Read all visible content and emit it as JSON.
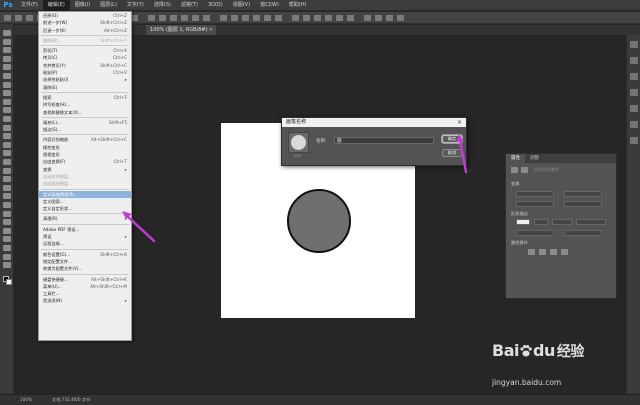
{
  "menubar": {
    "app_logo": "Ps",
    "items": [
      "文件(F)",
      "编辑(E)",
      "图像(I)",
      "图层(L)",
      "文字(Y)",
      "选择(S)",
      "滤镜(T)",
      "3D(D)",
      "视图(V)",
      "窗口(W)",
      "帮助(H)"
    ],
    "active_index": 1
  },
  "document_tab": {
    "label": "100% (图层 1, RGB/8#)",
    "close": "×"
  },
  "edit_menu": {
    "rows": [
      {
        "type": "item",
        "label": "还原(O)",
        "shortcut": "Ctrl+Z",
        "disabled": false
      },
      {
        "type": "item",
        "label": "前进一步(W)",
        "shortcut": "Shift+Ctrl+Z",
        "disabled": false
      },
      {
        "type": "item",
        "label": "后退一步(K)",
        "shortcut": "Alt+Ctrl+Z",
        "disabled": false
      },
      {
        "type": "sep"
      },
      {
        "type": "item",
        "label": "渐隐(D)...",
        "shortcut": "Shift+Ctrl+F",
        "disabled": true
      },
      {
        "type": "sep"
      },
      {
        "type": "item",
        "label": "剪切(T)",
        "shortcut": "Ctrl+X",
        "disabled": false
      },
      {
        "type": "item",
        "label": "拷贝(C)",
        "shortcut": "Ctrl+C",
        "disabled": false
      },
      {
        "type": "item",
        "label": "合并拷贝(Y)",
        "shortcut": "Shift+Ctrl+C",
        "disabled": false
      },
      {
        "type": "item",
        "label": "粘贴(P)",
        "shortcut": "Ctrl+V",
        "disabled": false
      },
      {
        "type": "item",
        "label": "选择性粘贴(I)",
        "shortcut": "▸",
        "disabled": false
      },
      {
        "type": "item",
        "label": "清除(E)",
        "shortcut": "",
        "disabled": false
      },
      {
        "type": "sep"
      },
      {
        "type": "item",
        "label": "搜索",
        "shortcut": "Ctrl+F",
        "disabled": false
      },
      {
        "type": "item",
        "label": "拼写检查(H)...",
        "shortcut": "",
        "disabled": false
      },
      {
        "type": "item",
        "label": "查找和替换文本(X)...",
        "shortcut": "",
        "disabled": false
      },
      {
        "type": "sep"
      },
      {
        "type": "item",
        "label": "填充(L)...",
        "shortcut": "Shift+F5",
        "disabled": false
      },
      {
        "type": "item",
        "label": "描边(S)...",
        "shortcut": "",
        "disabled": false
      },
      {
        "type": "sep"
      },
      {
        "type": "item",
        "label": "内容识别缩放",
        "shortcut": "Alt+Shift+Ctrl+C",
        "disabled": false
      },
      {
        "type": "item",
        "label": "操控变形",
        "shortcut": "",
        "disabled": false
      },
      {
        "type": "item",
        "label": "透视变形",
        "shortcut": "",
        "disabled": false
      },
      {
        "type": "item",
        "label": "自由变换(F)",
        "shortcut": "Ctrl+T",
        "disabled": false
      },
      {
        "type": "item",
        "label": "变换",
        "shortcut": "▸",
        "disabled": false
      },
      {
        "type": "item",
        "label": "自动对齐图层...",
        "shortcut": "",
        "disabled": true
      },
      {
        "type": "item",
        "label": "自动混合图层...",
        "shortcut": "",
        "disabled": true
      },
      {
        "type": "sep"
      },
      {
        "type": "item",
        "label": "定义画笔预设(B)...",
        "shortcut": "",
        "disabled": false,
        "highlight": true
      },
      {
        "type": "item",
        "label": "定义图案...",
        "shortcut": "",
        "disabled": false
      },
      {
        "type": "item",
        "label": "定义自定形状...",
        "shortcut": "",
        "disabled": false
      },
      {
        "type": "sep"
      },
      {
        "type": "item",
        "label": "清理(R)",
        "shortcut": "▸",
        "disabled": false
      },
      {
        "type": "sep"
      },
      {
        "type": "item",
        "label": "Adobe PDF 预设...",
        "shortcut": "",
        "disabled": false
      },
      {
        "type": "item",
        "label": "预设",
        "shortcut": "▸",
        "disabled": false
      },
      {
        "type": "item",
        "label": "远程连接...",
        "shortcut": "",
        "disabled": false
      },
      {
        "type": "sep"
      },
      {
        "type": "item",
        "label": "颜色设置(G)...",
        "shortcut": "Shift+Ctrl+K",
        "disabled": false
      },
      {
        "type": "item",
        "label": "指定配置文件...",
        "shortcut": "",
        "disabled": false
      },
      {
        "type": "item",
        "label": "转换为配置文件(V)...",
        "shortcut": "",
        "disabled": false
      },
      {
        "type": "sep"
      },
      {
        "type": "item",
        "label": "键盘快捷键...",
        "shortcut": "Alt+Shift+Ctrl+K",
        "disabled": false
      },
      {
        "type": "item",
        "label": "菜单(U)...",
        "shortcut": "Alt+Shift+Ctrl+M",
        "disabled": false
      },
      {
        "type": "item",
        "label": "工具栏...",
        "shortcut": "",
        "disabled": false
      },
      {
        "type": "item",
        "label": "首选项(N)",
        "shortcut": "▸",
        "disabled": false
      }
    ]
  },
  "dialog": {
    "title": "画笔名称",
    "close": "×",
    "name_label": "名称:",
    "name_value": "圆",
    "preview_size": "230",
    "ok_label": "确定",
    "cancel_label": "取消"
  },
  "properties_panel": {
    "tabs": [
      "属性",
      "调整"
    ],
    "shape_label": "实时形状属性",
    "transform_label": "变换",
    "stroke_label": "形状描边",
    "ops_label": "路径操作"
  },
  "statusbar": {
    "zoom": "100%",
    "doc_info": "文档:732.4K/0 字节"
  },
  "watermark": {
    "brand": "Bai",
    "brand_end": "du",
    "cn": "经验",
    "url": "jingyan.baidu.com"
  },
  "colors": {
    "accent_arrow": "#c23ad8",
    "highlight": "#8fb3da",
    "ps_blue": "#31a8ff"
  }
}
